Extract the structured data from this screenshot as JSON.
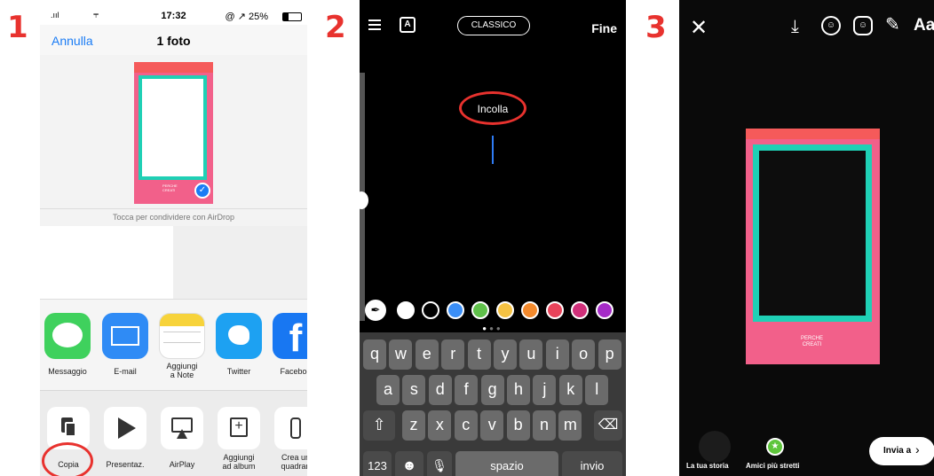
{
  "steps": [
    "1",
    "2",
    "3"
  ],
  "panel1": {
    "status": {
      "time": "17:32",
      "battery": "@ ↗ 25%"
    },
    "cancel": "Annulla",
    "title": "1 foto",
    "airdrop_hint": "Tocca per condividere con AirDrop",
    "apps": [
      {
        "label": "Messaggio",
        "color": "#3fd15d"
      },
      {
        "label": "E-mail",
        "color": "#2f8bf5"
      },
      {
        "label": "Aggiungi\na Note",
        "color": "#f7d33a"
      },
      {
        "label": "Twitter",
        "color": "#1da1f2"
      },
      {
        "label": "Faceboo",
        "color": "#1877f2"
      }
    ],
    "actions": [
      "Copia",
      "Presentaz.",
      "AirPlay",
      "Aggiungi\nad album",
      "Crea un\nquadran"
    ]
  },
  "panel2": {
    "menu_icon": "text-align-icon",
    "font_button": "A",
    "style_pill": "CLASSICO",
    "done": "Fine",
    "paste_bubble": "Incolla",
    "palette": [
      "#ffffff",
      "#000000",
      "#3a8ef6",
      "#5fc04a",
      "#f5c243",
      "#f38a2d",
      "#e8435a",
      "#d0307a",
      "#a52bc7"
    ],
    "keyboard": {
      "row1": [
        "q",
        "w",
        "e",
        "r",
        "t",
        "y",
        "u",
        "i",
        "o",
        "p"
      ],
      "row2": [
        "a",
        "s",
        "d",
        "f",
        "g",
        "h",
        "j",
        "k",
        "l"
      ],
      "row3": [
        "z",
        "x",
        "c",
        "v",
        "b",
        "n",
        "m"
      ],
      "numbers": "123",
      "space": "spazio",
      "return": "invio"
    }
  },
  "panel3": {
    "top_right_text": "Aa",
    "your_story": "La tua storia",
    "close_friends": "Amici più stretti",
    "send_to": "Invia a"
  }
}
